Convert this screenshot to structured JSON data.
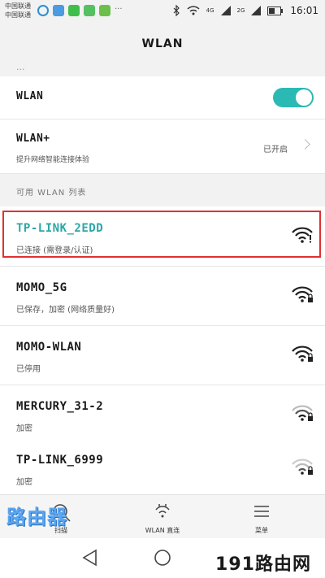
{
  "status_bar": {
    "carrier_1": "中国联通",
    "carrier_2": "中国联通",
    "time": "16:01",
    "net_1": "4G",
    "net_2": "2G"
  },
  "header": {
    "title": "WLAN"
  },
  "partial_row": {
    "text": "..."
  },
  "wlan_toggle": {
    "label": "WLAN",
    "on": true,
    "color": "#2bb9b4"
  },
  "wlan_plus": {
    "label": "WLAN+",
    "subtitle": "提升网络智能连接体验",
    "status": "已开启"
  },
  "section": {
    "title": "可用 WLAN 列表"
  },
  "networks": [
    {
      "name": "TP-LINK_2EDD",
      "status": "已连接 (需登录/认证)",
      "connected": true
    },
    {
      "name": "MOMO_5G",
      "status": "已保存，加密 (网络质量好)",
      "connected": false
    },
    {
      "name": "MOMO-WLAN",
      "status": "已停用",
      "connected": false
    },
    {
      "name": "MERCURY_31-2",
      "status": "加密",
      "connected": false
    },
    {
      "name": "TP-LINK_6999",
      "status": "加密",
      "connected": false
    }
  ],
  "bottom_bar": {
    "scan": "扫描",
    "direct": "WLAN 直连",
    "menu": "菜单"
  },
  "watermarks": {
    "left": "路由器",
    "right": "191路由网"
  },
  "colors": {
    "accent": "#2aa7a8",
    "highlight": "#e03030"
  }
}
